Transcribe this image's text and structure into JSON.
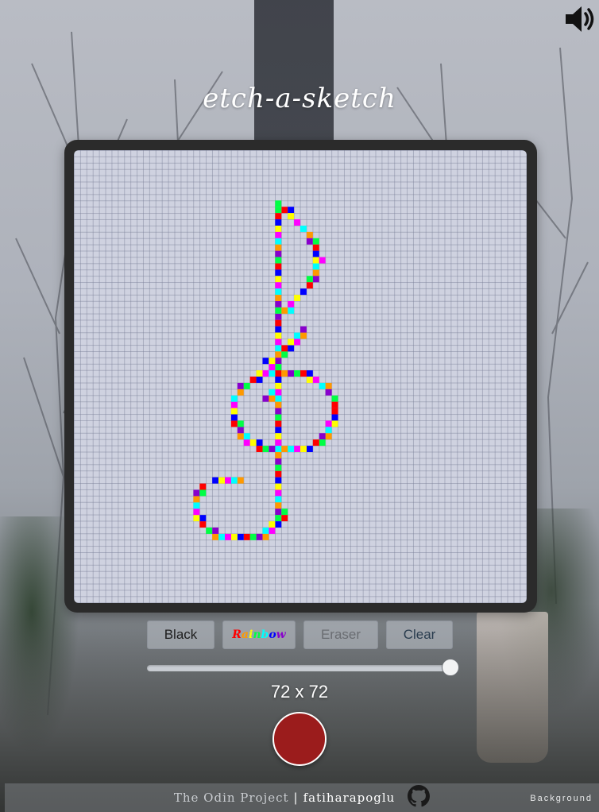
{
  "app": {
    "title": "etch-a-sketch"
  },
  "controls": {
    "black_label": "Black",
    "rainbow_label": "Rainbow",
    "eraser_label": "Eraser",
    "clear_label": "Clear",
    "grid_size": 72,
    "grid_size_min": 1,
    "grid_size_max": 72,
    "grid_size_label": "72 x 72",
    "current_color": "#9b1c1c"
  },
  "colors": {
    "rainbow_palette": [
      "#ff0000",
      "#ff9900",
      "#ffff00",
      "#00ff44",
      "#00ffff",
      "#0000ff",
      "#8800cc",
      "#ff00ff"
    ],
    "frame": "#2b2b2b",
    "grid_bg": "#cfd2e0"
  },
  "icons": {
    "speaker": "speaker-icon",
    "github": "github-icon"
  },
  "footer": {
    "odin_link": "The Odin Project",
    "separator": "|",
    "author": "fatiharapoglu",
    "background_link": "Background"
  }
}
